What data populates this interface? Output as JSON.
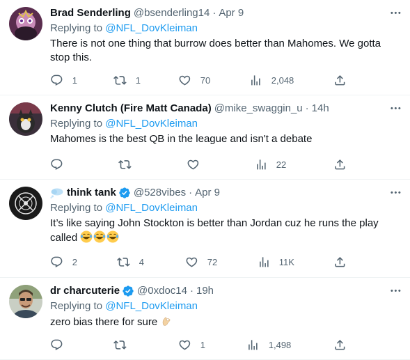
{
  "tweets": [
    {
      "name": "Brad Senderling",
      "handle": "@bsenderling14",
      "time": "Apr 9",
      "replying_prefix": "Replying to ",
      "replying_handle": "@NFL_DovKleiman",
      "text_lines": [
        "There is not one thing that burrow does better than Mahomes. We gotta",
        "stop this."
      ],
      "replies": "1",
      "reposts": "1",
      "likes": "70",
      "views": "2,048",
      "verified": false
    },
    {
      "name": "Kenny Clutch (Fire Matt Canada)",
      "handle": "@mike_swaggin_u",
      "time": "14h",
      "replying_prefix": "Replying to ",
      "replying_handle": "@NFL_DovKleiman",
      "text_lines": [
        "Mahomes is the best QB in the league and isn't a debate"
      ],
      "replies": "",
      "reposts": "",
      "likes": "",
      "views": "22",
      "verified": false
    },
    {
      "name": "think tank",
      "handle": "@528vibes",
      "time": "Apr 9",
      "replying_prefix": "Replying to ",
      "replying_handle": "@NFL_DovKleiman",
      "text_lines": [
        "It’s like saying John Stockton is better than Jordan cuz he runs the play",
        "called"
      ],
      "replies": "2",
      "reposts": "4",
      "likes": "72",
      "views": "11K",
      "verified": true
    },
    {
      "name": "dr charcuterie",
      "handle": "@0xdoc14",
      "time": "19h",
      "replying_prefix": "Replying to ",
      "replying_handle": "@NFL_DovKleiman",
      "text_lines": [
        "zero bias there for sure"
      ],
      "replies": "",
      "reposts": "",
      "likes": "1",
      "views": "1,498",
      "verified": true
    }
  ],
  "colors": {
    "text": "#0f1419",
    "muted": "#536471",
    "link": "#1d9bf0",
    "divider": "#eff3f4"
  },
  "icons": [
    "reply-icon",
    "repost-icon",
    "like-icon",
    "views-icon",
    "share-icon",
    "more-icon",
    "verified-icon"
  ]
}
